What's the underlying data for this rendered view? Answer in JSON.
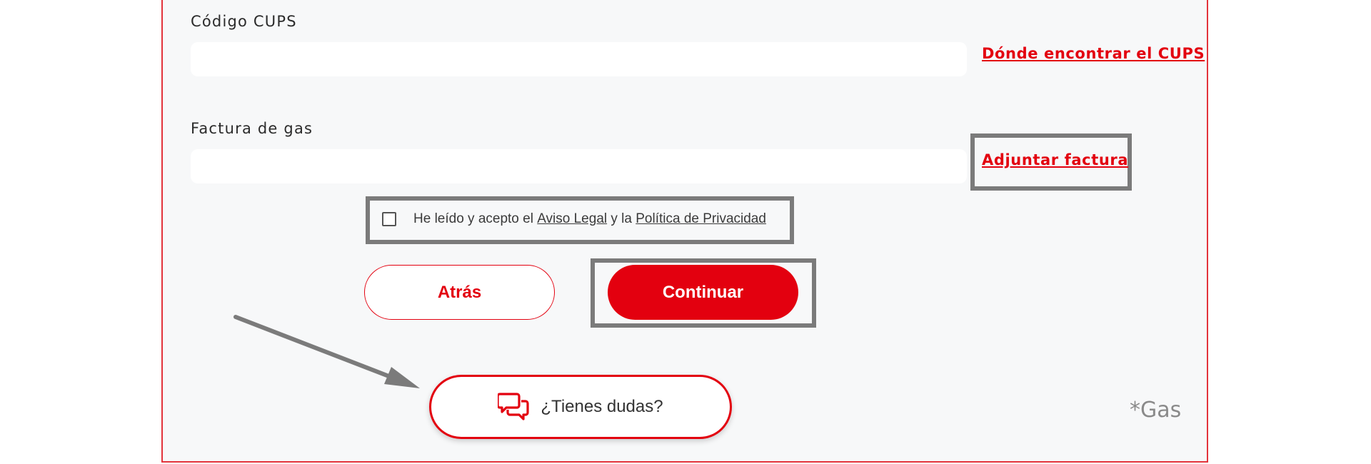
{
  "form": {
    "cups": {
      "label": "Código CUPS",
      "value": "",
      "help_link": "Dónde encontrar el CUPS"
    },
    "invoice": {
      "label": "Factura de gas",
      "value": "",
      "attach_link": "Adjuntar factura"
    },
    "consent": {
      "checked": false,
      "text_before": "He leído y acepto el ",
      "legal_link": "Aviso Legal",
      "text_middle": " y la ",
      "privacy_link": "Política de Privacidad"
    }
  },
  "actions": {
    "back_label": "Atrás",
    "continue_label": "Continuar"
  },
  "help": {
    "label": "¿Tienes dudas?",
    "icon": "chat-bubbles-icon"
  },
  "footnote": "*Gas",
  "colors": {
    "brand_red": "#e3000f",
    "annotation_gray": "#7b7b7b",
    "panel_bg": "#f7f8f9"
  }
}
